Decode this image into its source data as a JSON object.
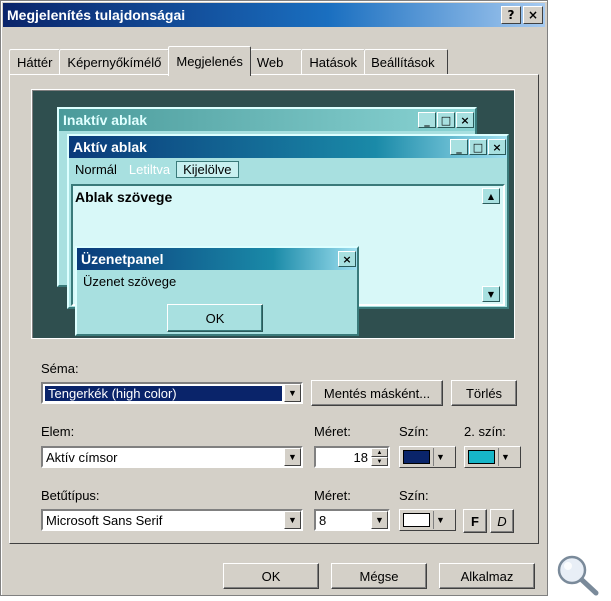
{
  "window": {
    "title": "Megjelenítés tulajdonságai",
    "help_btn": "?",
    "close_btn": "×"
  },
  "tabs": [
    "Háttér",
    "Képernyőkímélő",
    "Megjelenés",
    "Web",
    "Hatások",
    "Beállítások"
  ],
  "active_tab": "Megjelenés",
  "preview": {
    "inactive_title": "Inaktív ablak",
    "active_title": "Aktív ablak",
    "menu": [
      "Normál",
      "Letiltva",
      "Kijelölve"
    ],
    "window_text": "Ablak szövege",
    "msgbox_title": "Üzenetpanel",
    "msgbox_text": "Üzenet szövege",
    "msgbox_ok": "OK"
  },
  "scheme": {
    "label": "Séma:",
    "value": "Tengerkék (high color)",
    "save_as": "Mentés másként...",
    "delete": "Törlés"
  },
  "item": {
    "label": "Elem:",
    "value": "Aktív címsor",
    "size_label": "Méret:",
    "size_value": "18",
    "color_label": "Szín:",
    "color2_label": "2. szín:",
    "color": "#0a246a",
    "color2": "#16b5c8"
  },
  "font": {
    "label": "Betűtípus:",
    "value": "Microsoft Sans Serif",
    "size_label": "Méret:",
    "size_value": "8",
    "color_label": "Szín:",
    "color": "#ffffff",
    "bold": "F",
    "italic": "D"
  },
  "footer": {
    "ok": "OK",
    "cancel": "Mégse",
    "apply": "Alkalmaz"
  }
}
